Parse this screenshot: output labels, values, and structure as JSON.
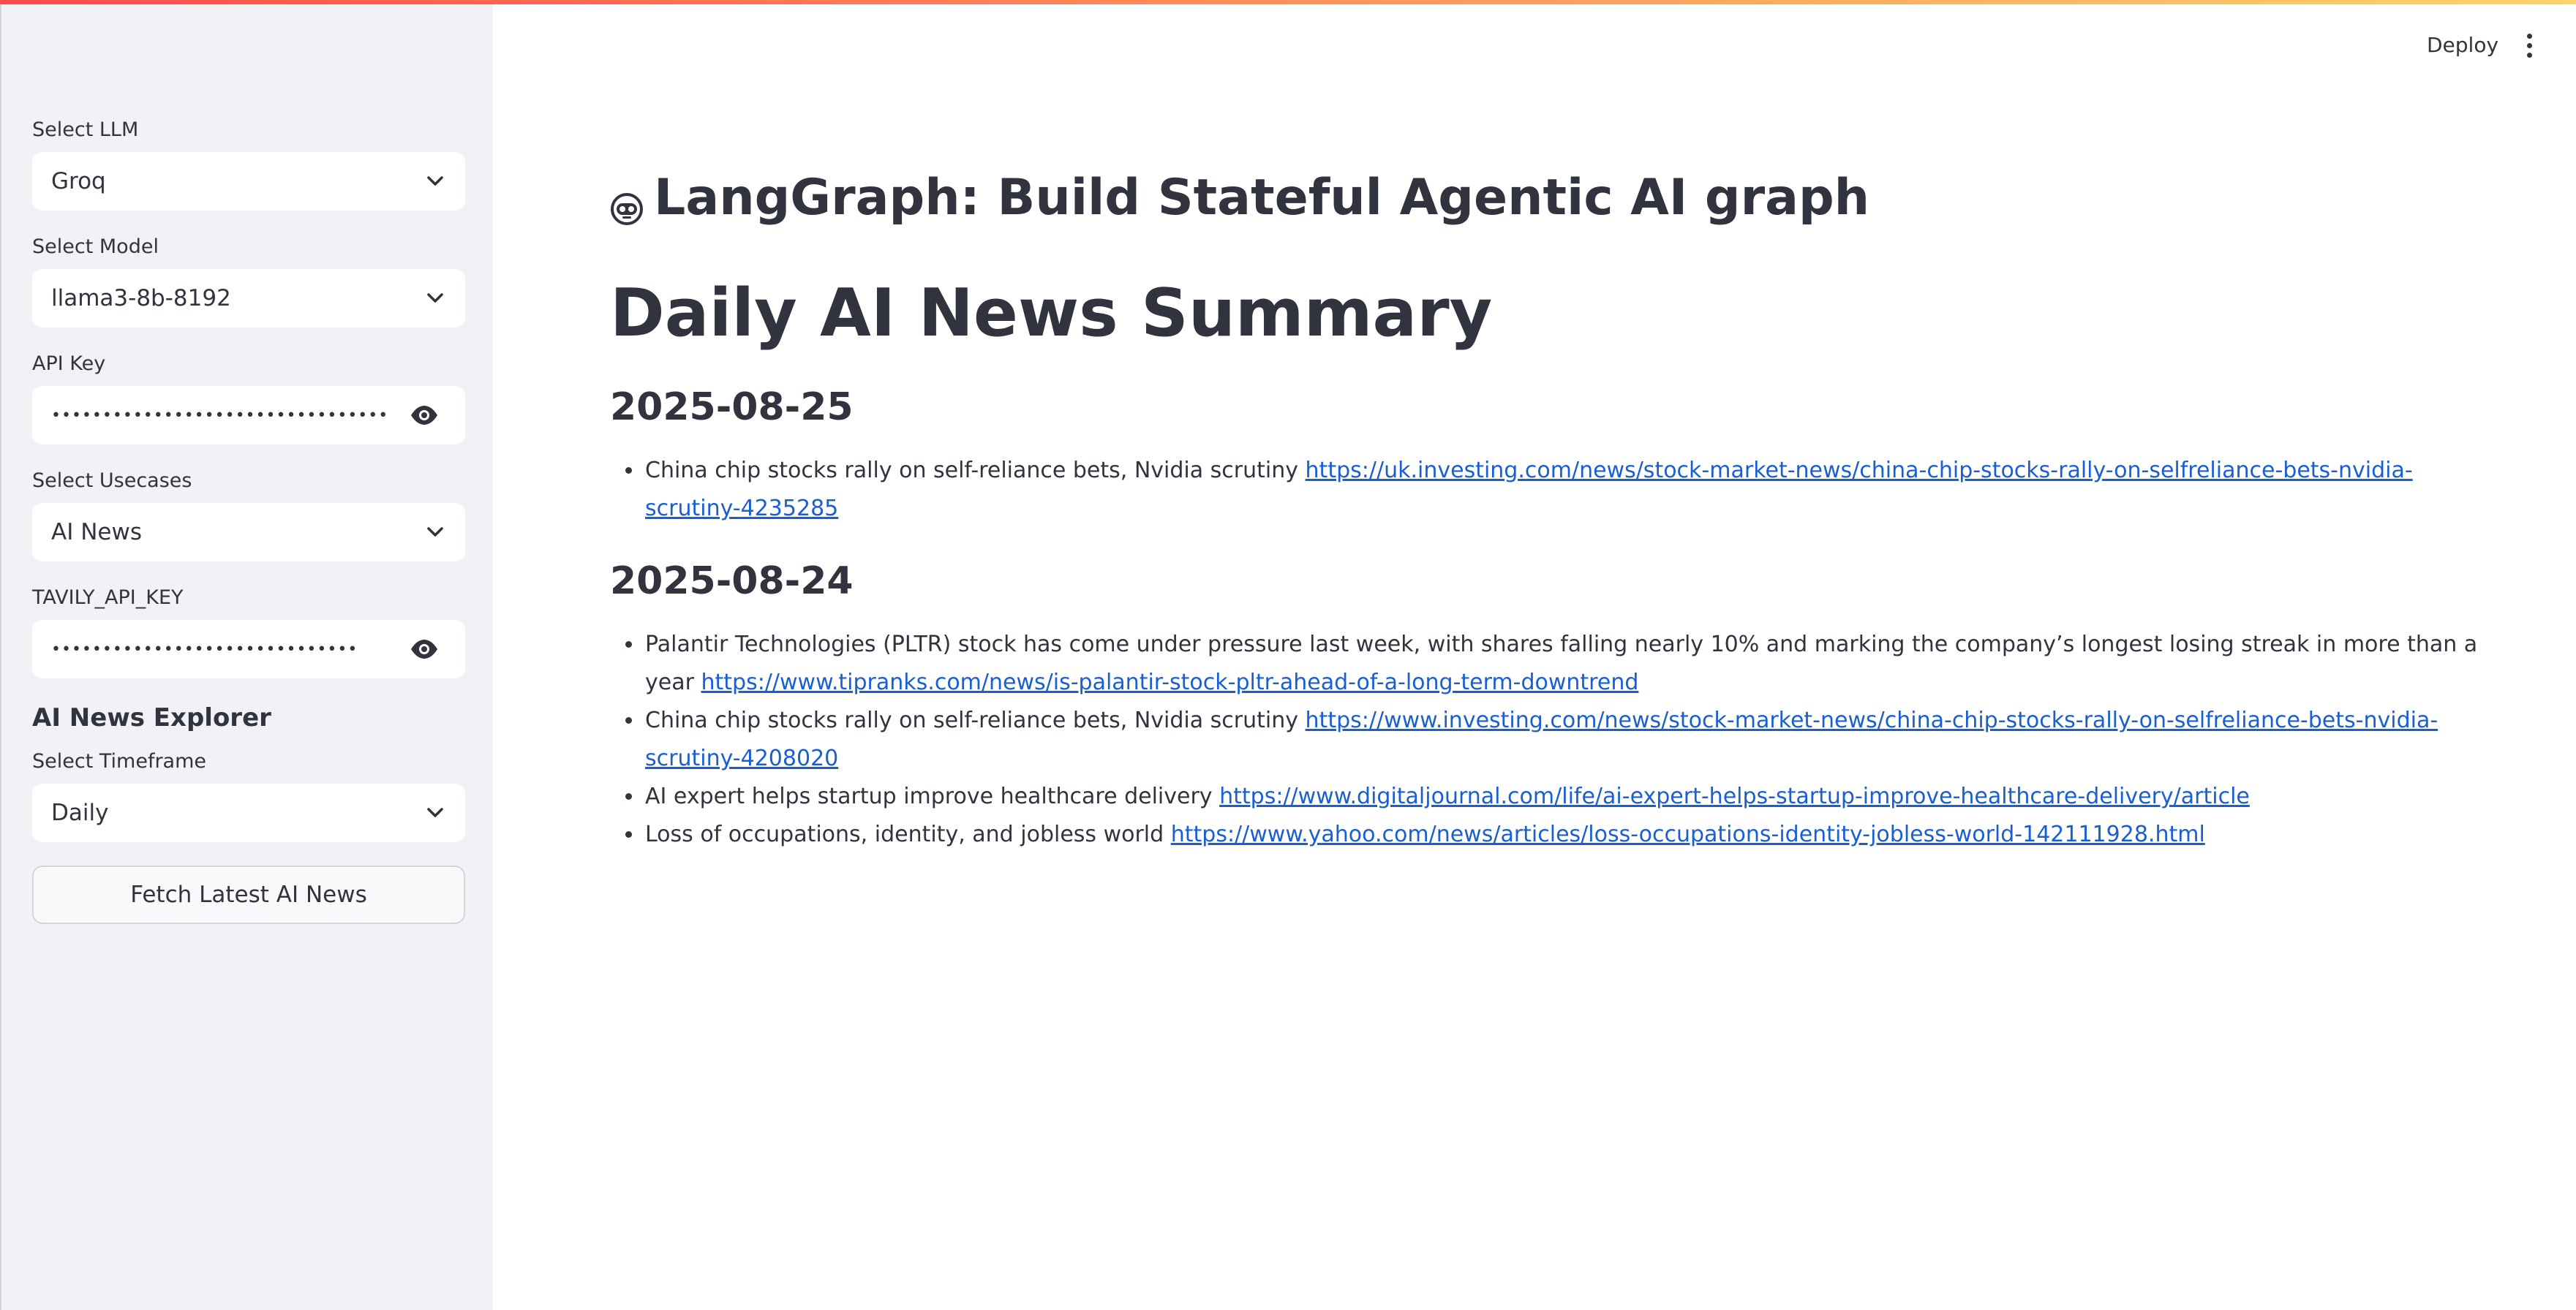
{
  "header": {
    "deploy_label": "Deploy"
  },
  "sidebar": {
    "llm": {
      "label": "Select LLM",
      "value": "Groq"
    },
    "model": {
      "label": "Select Model",
      "value": "llama3-8b-8192"
    },
    "api_key": {
      "label": "API Key",
      "value": "••••••••••••••••••••••••••••••••••••••••••••••••••••••"
    },
    "usecase": {
      "label": "Select Usecases",
      "value": "AI News"
    },
    "tavily": {
      "label": "TAVILY_API_KEY",
      "value": "•••••••••••••••••••••••••••••••••••••••••••••••••••"
    },
    "explorer_heading": "AI News Explorer",
    "timeframe": {
      "label": "Select Timeframe",
      "value": "Daily"
    },
    "fetch_button_label": "Fetch Latest AI News"
  },
  "main": {
    "app_title": "LangGraph: Build Stateful Agentic AI graph",
    "page_title": "Daily AI News Summary",
    "days": [
      {
        "date": "2025-08-25",
        "items": [
          {
            "text": "China chip stocks rally on self-reliance bets, Nvidia scrutiny",
            "link": "https://uk.investing.com/news/stock-market-news/china-chip-stocks-rally-on-selfreliance-bets-nvidia-scrutiny-4235285"
          }
        ]
      },
      {
        "date": "2025-08-24",
        "items": [
          {
            "text": "Palantir Technologies (PLTR) stock has come under pressure last week, with shares falling nearly 10% and marking the company’s longest losing streak in more than a year",
            "link": "https://www.tipranks.com/news/is-palantir-stock-pltr-ahead-of-a-long-term-downtrend"
          },
          {
            "text": "China chip stocks rally on self-reliance bets, Nvidia scrutiny",
            "link": "https://www.investing.com/news/stock-market-news/china-chip-stocks-rally-on-selfreliance-bets-nvidia-scrutiny-4208020"
          },
          {
            "text": "AI expert helps startup improve healthcare delivery",
            "link": "https://www.digitaljournal.com/life/ai-expert-helps-startup-improve-healthcare-delivery/article"
          },
          {
            "text": "Loss of occupations, identity, and jobless world",
            "link": "https://www.yahoo.com/news/articles/loss-occupations-identity-jobless-world-142111928.html"
          }
        ]
      }
    ]
  },
  "icons": {
    "select_chevron": "chevron-down-icon",
    "password_toggle": "eye-icon",
    "app_title_icon": "robot-face-icon",
    "main_menu": "kebab-menu-icon"
  },
  "colors": {
    "sidebar_bg": "#f0f2f6",
    "text": "#31333f",
    "link": "#1a5fd0",
    "accent_gradient": [
      "#ff4b4b",
      "#fdd36a"
    ]
  }
}
